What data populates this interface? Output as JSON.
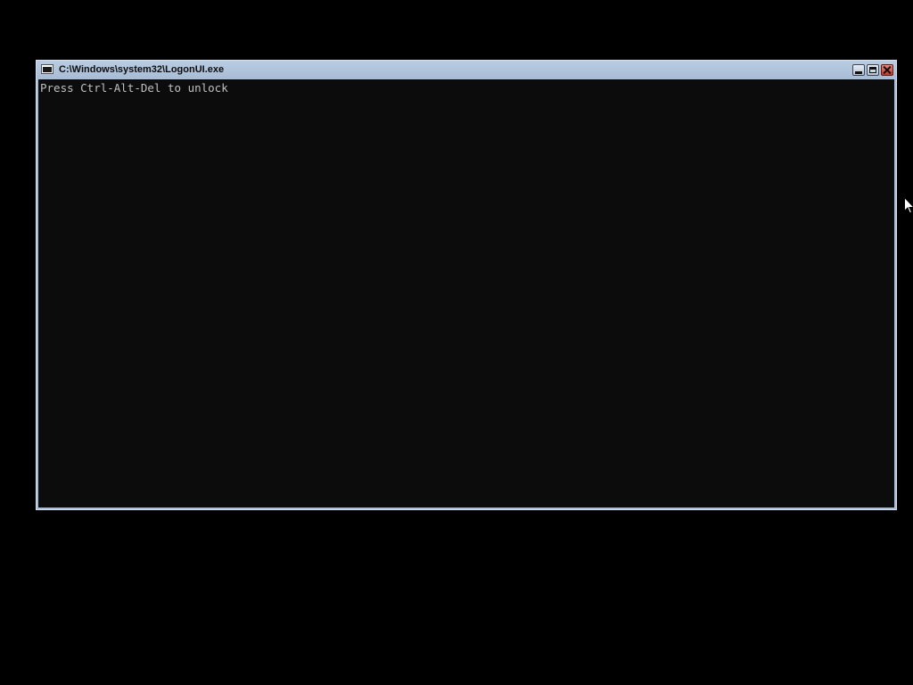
{
  "window": {
    "title": "C:\\Windows\\system32\\LogonUI.exe",
    "icon": "console-window-icon",
    "buttons": {
      "minimize_icon": "minimize-icon",
      "maximize_icon": "maximize-icon",
      "close_icon": "close-icon"
    }
  },
  "console": {
    "lines": [
      "Press Ctrl-Alt-Del to unlock"
    ],
    "text_color": "#c0c0c0",
    "background": "#0c0c0c"
  },
  "colors": {
    "desktop": "#000000",
    "title_bar": "#a9bed6",
    "close_button": "#c0392b"
  }
}
